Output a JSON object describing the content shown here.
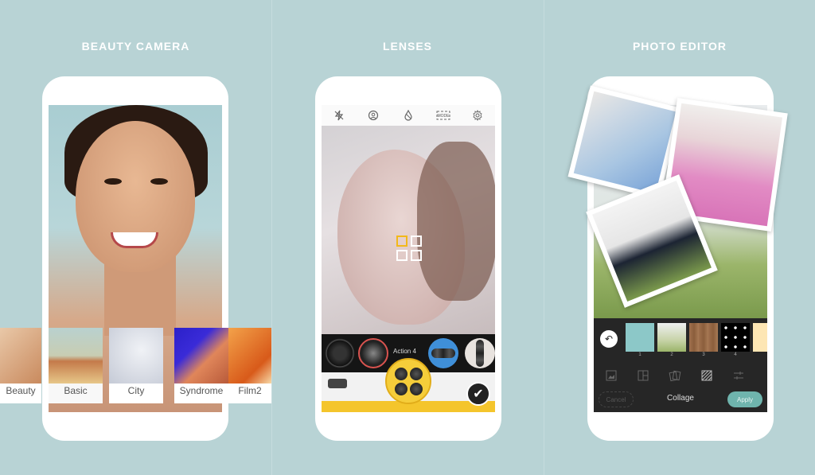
{
  "panels": [
    {
      "title": "BEAUTY CAMERA",
      "filters": [
        {
          "label": "Beauty"
        },
        {
          "label": "Basic"
        },
        {
          "label": "City"
        },
        {
          "label": "Syndrome"
        },
        {
          "label": "Film2"
        }
      ]
    },
    {
      "title": "LENSES",
      "toolbar": [
        "flash-off",
        "face",
        "drop",
        "MODE",
        "settings"
      ],
      "lens_label": "Action 4",
      "check": "✔"
    },
    {
      "title": "PHOTO EDITOR",
      "backgrounds": [
        "1",
        "2",
        "3",
        "4"
      ],
      "undo": "↶",
      "cancel_label": "Cancel",
      "mode_label": "Collage",
      "apply_label": "Apply"
    }
  ],
  "colors": {
    "background": "#b8d3d5",
    "accent_yellow": "#f4c52c",
    "apply_teal": "#6fb4ad"
  }
}
